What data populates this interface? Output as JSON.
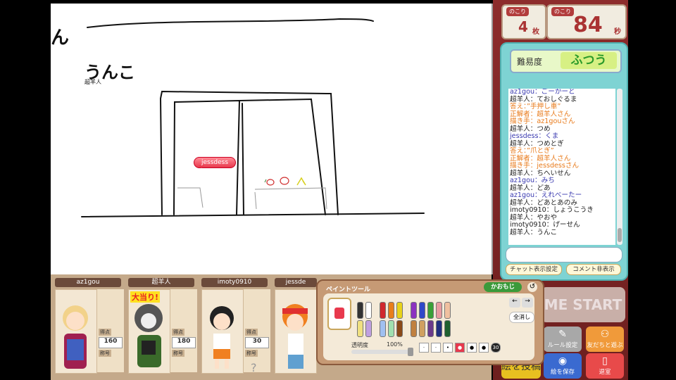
{
  "canvas": {
    "drawn_text_1": "ん",
    "drawn_text_2": "うんこ",
    "drawn_author": "超羊人",
    "marker_name": "jessdess"
  },
  "counters": {
    "remaining_label": "のこり",
    "cards_value": "4",
    "cards_unit": "枚",
    "time_label": "のこり",
    "time_value": "84",
    "time_unit": "秒"
  },
  "chat": {
    "difficulty_label": "難易度",
    "difficulty_value": "ふつう",
    "lines": [
      {
        "text": "az1gou：ごーかーと",
        "color": "#3a3ab0"
      },
      {
        "text": "超羊人：ておしぐるま",
        "color": "#222"
      },
      {
        "text": "答え：”手押し車”",
        "color": "#e87a1a"
      },
      {
        "text": "正解者：超羊人さん",
        "color": "#e87a1a"
      },
      {
        "text": "描き手：az1gouさん",
        "color": "#e87a1a"
      },
      {
        "text": "超羊人：つめ",
        "color": "#222"
      },
      {
        "text": "jessdess：くま",
        "color": "#3a3ab0"
      },
      {
        "text": "超羊人：つめとぎ",
        "color": "#222"
      },
      {
        "text": "答え：”爪とぎ”",
        "color": "#e87a1a"
      },
      {
        "text": "正解者：超羊人さん",
        "color": "#e87a1a"
      },
      {
        "text": "描き手：jessdessさん",
        "color": "#e87a1a"
      },
      {
        "text": "超羊人：ちへいせん",
        "color": "#222"
      },
      {
        "text": "az1gou：みち",
        "color": "#3a3ab0"
      },
      {
        "text": "超羊人：どあ",
        "color": "#222"
      },
      {
        "text": "az1gou：えれべーたー",
        "color": "#3a3ab0"
      },
      {
        "text": "超羊人：どあとあのみ",
        "color": "#222"
      },
      {
        "text": "imoty0910：しょうこうき",
        "color": "#222"
      },
      {
        "text": "超羊人：やおや",
        "color": "#222"
      },
      {
        "text": "imoty0910：げーせん",
        "color": "#222"
      },
      {
        "text": "超羊人：うんこ",
        "color": "#222"
      }
    ],
    "input_value": "",
    "btn_chat_display": "チャット表示設定",
    "btn_comment_hide": "コメント非表示"
  },
  "game_start_label": "ME START",
  "side_buttons": {
    "rules": "ルール設定",
    "invite": "友だちと遊ぶ",
    "post": "絵を投稿",
    "save": "絵を保存",
    "exit": "退室"
  },
  "players": [
    {
      "name": "az1gou",
      "score_label": "得点",
      "score": "160",
      "title_label": "称号",
      "badge": ""
    },
    {
      "name": "超羊人",
      "score_label": "得点",
      "score": "180",
      "title_label": "称号",
      "badge": "大当り!"
    },
    {
      "name": "imoty0910",
      "score_label": "得点",
      "score": "30",
      "title_label": "称号",
      "badge": ""
    },
    {
      "name": "jessde",
      "score_label": "",
      "score": "",
      "title_label": "",
      "badge": ""
    }
  ],
  "paint": {
    "title": "ペイントツール",
    "kaomoji_btn": "かおもじ",
    "opacity_label": "透明度",
    "opacity_value": "100%",
    "clear_btn": "全消し",
    "brush_size_max": "30",
    "pen_colors": [
      "#333333",
      "#ffffff",
      "#d0282e",
      "#e87e1a",
      "#e8d21a",
      "#8c32c0",
      "#3048c8",
      "#3aa038",
      "#e89aa0",
      "#f0c0a0",
      "#f0e080",
      "#c0a0e0",
      "#a0c0f0",
      "#a0e0b0",
      "#8a4a1a",
      "#c08040",
      "#d0a060",
      "#6a3a8a",
      "#203080",
      "#206030"
    ],
    "accent": "#e8394d"
  }
}
